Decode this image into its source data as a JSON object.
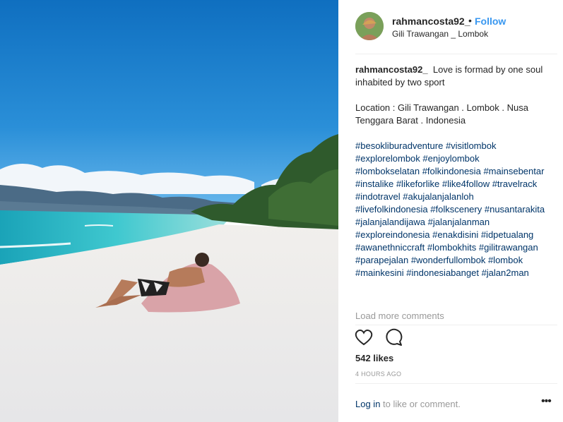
{
  "post": {
    "username": "rahmancosta92_",
    "separator": "•",
    "follow_label": "Follow",
    "location": "Gili Trawangan _ Lombok"
  },
  "caption": {
    "username": "rahmancosta92_",
    "text": "Love is formad by one soul inhabited by two sport",
    "location_line": "Location : Gili Trawangan . Lombok . Nusa Tenggara Barat . Indonesia",
    "hashtags": [
      "#besokliburadventure",
      "#visitlombok",
      "#explorelombok",
      "#enjoylombok",
      "#lombokselatan",
      "#folkindonesia",
      "#mainsebentar",
      "#instalike",
      "#likeforlike",
      "#like4follow",
      "#travelrack",
      "#indotravel",
      "#akujalanjalanloh",
      "#livefolkindonesia",
      "#folkscenery",
      "#nusantarakita",
      "#jalanjalandijawa",
      "#jalanjalanman",
      "#exploreindonesia",
      "#enakdisini",
      "#idpetualang",
      "#awanethniccraft",
      "#lombokhits",
      "#gilitrawangan",
      "#parapejalan",
      "#wonderfullombok",
      "#lombok",
      "#mainkesini",
      "#indonesiabanget",
      "#jalan2man"
    ]
  },
  "comments": {
    "load_more_label": "Load more comments"
  },
  "actions": {
    "like_icon": "heart-icon",
    "comment_icon": "comment-icon"
  },
  "likes": "542 likes",
  "timestamp": "4 HOURS AGO",
  "footer": {
    "login_label": "Log in",
    "rest": "to like or comment.",
    "more_label": "•••"
  },
  "colors": {
    "link_blue": "#3897f0",
    "hashtag": "#003569",
    "muted": "#999999",
    "text": "#262626"
  }
}
